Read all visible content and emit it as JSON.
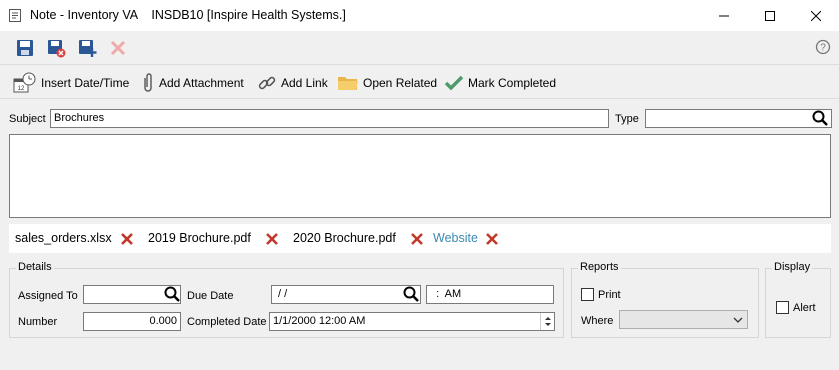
{
  "window": {
    "title": "Note - Inventory VA    INSDB10 [Inspire Health Systems.]",
    "minimize_icon": "minimize-icon",
    "maximize_icon": "maximize-icon",
    "close_icon": "close-icon"
  },
  "toolbar": {
    "icons": [
      "save-icon",
      "save-close-icon",
      "save-new-icon",
      "delete-icon",
      "help-icon"
    ],
    "actions": {
      "insert_datetime": "Insert Date/Time",
      "add_attachment": "Add Attachment",
      "add_link": "Add Link",
      "open_related": "Open Related",
      "mark_completed": "Mark Completed"
    }
  },
  "form": {
    "subject_label": "Subject",
    "subject_value": "Brochures",
    "type_label": "Type",
    "type_value": ""
  },
  "attachments": [
    {
      "name": "sales_orders.xlsx",
      "is_link": false
    },
    {
      "name": "2019 Brochure.pdf",
      "is_link": false
    },
    {
      "name": "2020 Brochure.pdf",
      "is_link": false
    },
    {
      "name": "Website",
      "is_link": true
    }
  ],
  "details": {
    "title": "Details",
    "assigned_to_label": "Assigned To",
    "assigned_to_value": "",
    "due_date_label": "Due Date",
    "due_date_value": " / /",
    "due_time_value": "  :  AM",
    "number_label": "Number",
    "number_value": "0.000",
    "completed_date_label": "Completed Date",
    "completed_date_value": "1/1/2000 12:00 AM"
  },
  "reports": {
    "title": "Reports",
    "print_label": "Print",
    "print_checked": false,
    "where_label": "Where",
    "where_value": ""
  },
  "display": {
    "title": "Display",
    "alert_label": "Alert",
    "alert_checked": false
  },
  "colors": {
    "accent_blue": "#2b5797",
    "delete_red": "#c0392b",
    "link": "#3c89b0",
    "check_green": "#4e9a6a"
  }
}
